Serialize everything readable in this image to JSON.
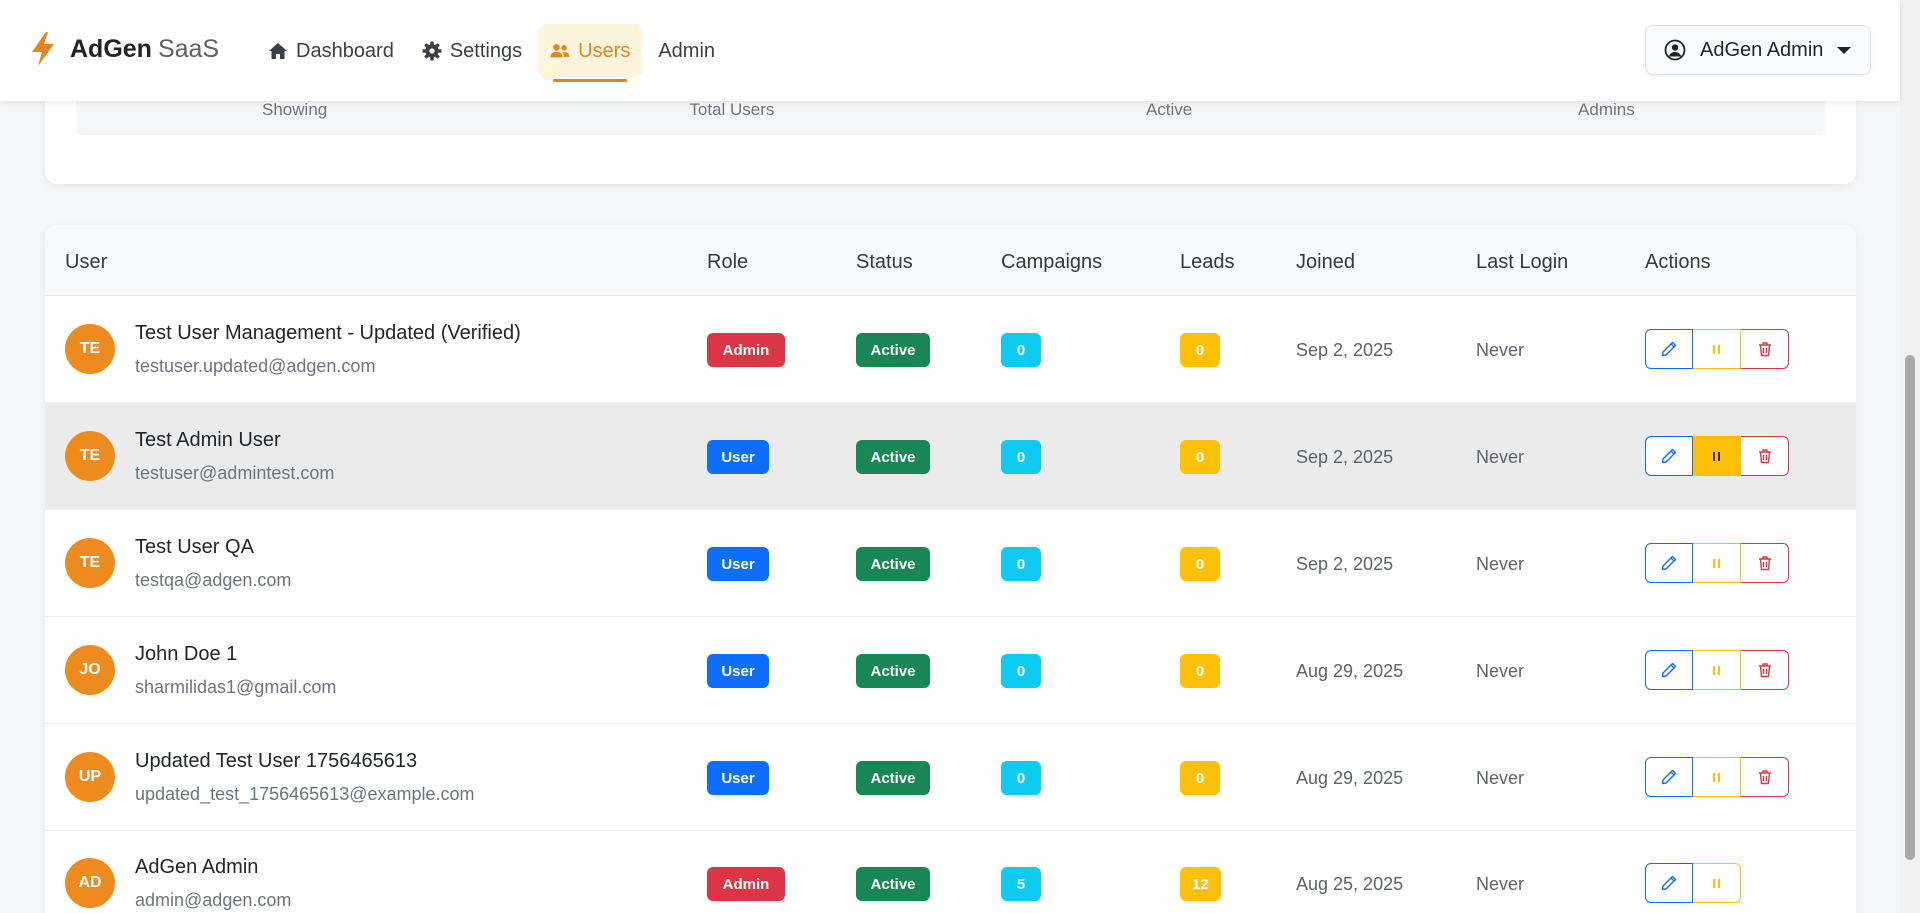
{
  "brand": {
    "name_strong": "AdGen",
    "name_light": "SaaS",
    "accent": "#e8851a"
  },
  "nav": [
    {
      "label": "Dashboard",
      "icon": "home-icon",
      "active": false
    },
    {
      "label": "Settings",
      "icon": "gear-icon",
      "active": false
    },
    {
      "label": "Users",
      "icon": "users-icon",
      "active": true
    },
    {
      "label": "Admin",
      "icon": "",
      "active": false
    }
  ],
  "user_menu": {
    "label": "AdGen Admin",
    "icon": "user-circle-icon"
  },
  "stats": {
    "labels": [
      "Showing",
      "Total Users",
      "Active",
      "Admins"
    ]
  },
  "table": {
    "headers": {
      "user": "User",
      "role": "Role",
      "status": "Status",
      "campaigns": "Campaigns",
      "leads": "Leads",
      "joined": "Joined",
      "last_login": "Last Login",
      "actions": "Actions"
    },
    "rows": [
      {
        "initials": "TE",
        "name": "Test User Management - Updated (Verified)",
        "email": "testuser.updated@adgen.com",
        "role": "Admin",
        "status": "Active",
        "campaigns": "0",
        "leads": "0",
        "joined": "Sep 2, 2025",
        "last_login": "Never"
      },
      {
        "initials": "TE",
        "name": "Test Admin User",
        "email": "testuser@admintest.com",
        "role": "User",
        "status": "Active",
        "campaigns": "0",
        "leads": "0",
        "joined": "Sep 2, 2025",
        "last_login": "Never"
      },
      {
        "initials": "TE",
        "name": "Test User QA",
        "email": "testqa@adgen.com",
        "role": "User",
        "status": "Active",
        "campaigns": "0",
        "leads": "0",
        "joined": "Sep 2, 2025",
        "last_login": "Never"
      },
      {
        "initials": "JO",
        "name": "John Doe 1",
        "email": "sharmilidas1@gmail.com",
        "role": "User",
        "status": "Active",
        "campaigns": "0",
        "leads": "0",
        "joined": "Aug 29, 2025",
        "last_login": "Never"
      },
      {
        "initials": "UP",
        "name": "Updated Test User 1756465613",
        "email": "updated_test_1756465613@example.com",
        "role": "User",
        "status": "Active",
        "campaigns": "0",
        "leads": "0",
        "joined": "Aug 29, 2025",
        "last_login": "Never"
      },
      {
        "initials": "AD",
        "name": "AdGen Admin",
        "email": "admin@adgen.com",
        "role": "Admin",
        "status": "Active",
        "campaigns": "5",
        "leads": "12",
        "joined": "Aug 25, 2025",
        "last_login": "Never"
      }
    ]
  },
  "colors": {
    "admin": "#dc3545",
    "user": "#0d6efd",
    "active": "#198754",
    "campaigns": "#0dcaf0",
    "leads": "#ffc107",
    "avatar": "#ee8b1f"
  }
}
